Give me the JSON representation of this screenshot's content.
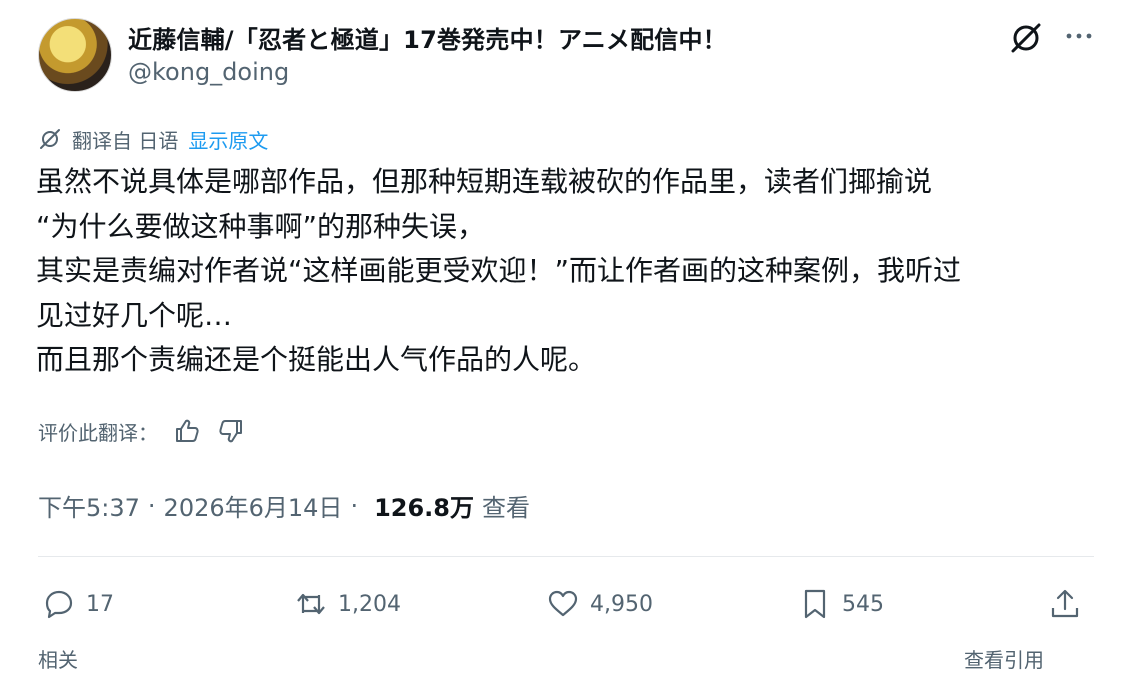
{
  "author": {
    "display_name": "近藤信輔/「忍者と極道」17巻発売中！アニメ配信中！",
    "handle": "@kong_doing"
  },
  "icons": {
    "grok": "grok-icon",
    "more": "more-icon",
    "translate": "translate-icon",
    "thumb_up": "thumb-up-icon",
    "thumb_down": "thumb-down-icon",
    "reply": "reply-icon",
    "repost": "repost-icon",
    "like": "heart-icon",
    "bookmark": "bookmark-icon",
    "share": "share-icon"
  },
  "translation": {
    "from_label": "翻译自 日语",
    "show_original": "显示原文"
  },
  "post": {
    "lines": [
      "虽然不说具体是哪部作品，但那种短期连载被砍的作品里，读者们揶揄说",
      "“为什么要做这种事啊”的那种失误，",
      "其实是责编对作者说“这样画能更受欢迎！”而让作者画的这种案例，我听过",
      "见过好几个呢…",
      "而且那个责编还是个挺能出人气作品的人呢。"
    ]
  },
  "rating": {
    "label": "评价此翻译："
  },
  "meta": {
    "time": "下午5:37",
    "date": "2026年6月14日",
    "separator": "·",
    "views_count": "126.8万",
    "views_label": "查看"
  },
  "actions": {
    "replies": "17",
    "reposts": "1,204",
    "likes": "4,950",
    "bookmarks": "545"
  },
  "cutoff": {
    "left": "相关",
    "right": "查看引用"
  },
  "colors": {
    "text": "#0f1419",
    "secondary": "#536471",
    "link": "#1d9bf0",
    "divider": "#e6e9ec"
  }
}
